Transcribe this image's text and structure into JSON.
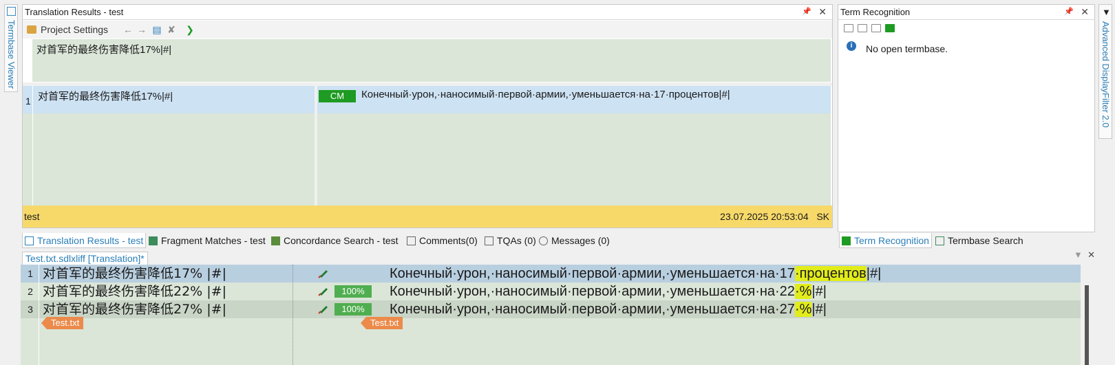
{
  "side": {
    "left_tab": "Termbase Viewer",
    "right_tab": "Advanced DisplayFilter 2.0"
  },
  "translation_results": {
    "title": "Translation Results - test",
    "toolbar": {
      "project_settings": "Project Settings"
    },
    "source_preview": "对首军的最终伤害降低17%|#|",
    "rows": [
      {
        "num": "1",
        "source": "对首军的最终伤害降低17%|#|",
        "origin_badge": "CM",
        "target": "Конечный·урон,·наносимый·первой·армии,·уменьшается·на·17·процентов|#|"
      }
    ],
    "status": {
      "name": "test",
      "timestamp": "23.07.2025 20:53:04",
      "user": "SK"
    }
  },
  "term_recognition": {
    "title": "Term Recognition",
    "message": "No open termbase."
  },
  "bottom_tabs": {
    "tabs": [
      "Translation Results - test",
      "Fragment Matches - test",
      "Concordance Search - test",
      "Comments(0)",
      "TQAs (0)",
      "Messages (0)"
    ],
    "right_tabs": [
      "Term Recognition",
      "Termbase Search"
    ]
  },
  "editor": {
    "doc_tab": "Test.txt.sdlxliff [Translation]*",
    "rows": [
      {
        "num": "1",
        "source": "对首军的最终伤害降低17%",
        "src_tag": "|#|",
        "pct": "",
        "target_pre": "Конечный·урон,·наносимый·первой·армии,·уменьшается·на·17",
        "target_hl": "·процентов",
        "target_post": "|#|"
      },
      {
        "num": "2",
        "source": "对首军的最终伤害降低22%",
        "src_tag": "|#|",
        "pct": "100%",
        "target_pre": "Конечный·урон,·наносимый·первой·армии,·уменьшается·на·22",
        "target_hl": "·%",
        "target_post": "|#|"
      },
      {
        "num": "3",
        "source": "对首军的最终伤害降低27%",
        "src_tag": "|#|",
        "pct": "100%",
        "target_pre": "Конечный·урон,·наносимый·первой·армии,·уменьшается·на·27",
        "target_hl": "·%",
        "target_post": "|#|"
      }
    ],
    "file_tag_source": "Test.txt",
    "file_tag_target": "Test.txt"
  },
  "colors": {
    "segment_bg": "#dbe6d8",
    "active_row": "#cde2f3",
    "status_bar": "#f7d96a",
    "match_badge": "#1e9b22",
    "highlight": "#e2ec1a",
    "file_tag": "#eb8a4a"
  }
}
